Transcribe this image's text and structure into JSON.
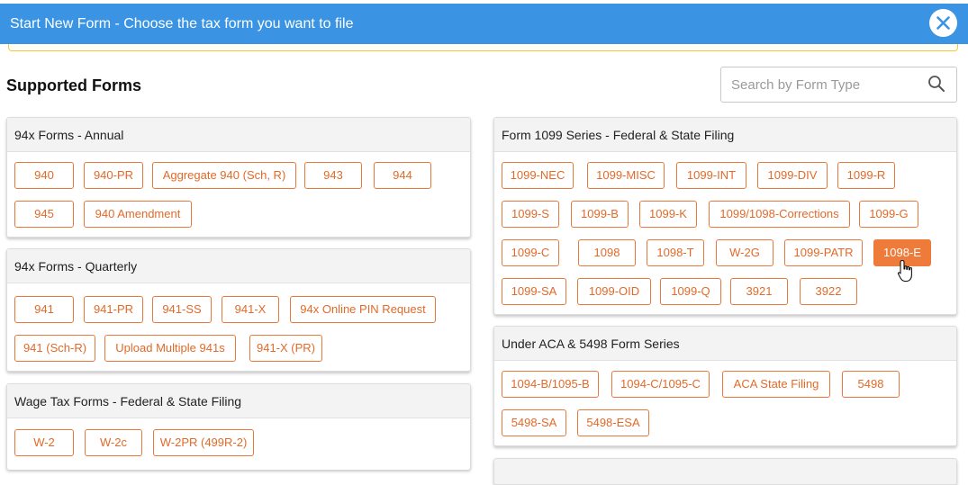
{
  "header": {
    "title": "Start New Form - Choose the tax form you want to file",
    "close_icon": "close-icon"
  },
  "main": {
    "section_title": "Supported Forms",
    "search": {
      "placeholder": "Search by Form Type",
      "value": "",
      "icon": "search-icon"
    }
  },
  "cards": {
    "annual": {
      "title": "94x Forms - Annual",
      "forms": [
        "940",
        "940-PR",
        "Aggregate 940 (Sch, R)",
        "943",
        "944",
        "945",
        "940 Amendment"
      ]
    },
    "quarterly": {
      "title": "94x Forms - Quarterly",
      "forms": [
        "941",
        "941-PR",
        "941-SS",
        "941-X",
        "94x Online PIN Request",
        "941 (Sch-R)",
        "Upload Multiple 941s",
        "941-X (PR)"
      ]
    },
    "wage": {
      "title": "Wage Tax Forms - Federal & State Filing",
      "forms": [
        "W-2",
        "W-2c",
        "W-2PR (499R-2)"
      ]
    },
    "f1099": {
      "title": "Form 1099 Series - Federal & State Filing",
      "forms": [
        "1099-NEC",
        "1099-MISC",
        "1099-INT",
        "1099-DIV",
        "1099-R",
        "1099-S",
        "1099-B",
        "1099-K",
        "1099/1098-Corrections",
        "1099-G",
        "1099-C",
        "1098",
        "1098-T",
        "W-2G",
        "1099-PATR",
        "1098-E",
        "1099-SA",
        "1099-OID",
        "1099-Q",
        "3921",
        "3922"
      ],
      "selected": "1098-E"
    },
    "aca": {
      "title": "Under ACA & 5498 Form Series",
      "forms": [
        "1094-B/1095-B",
        "1094-C/1095-C",
        "ACA State Filing",
        "5498",
        "5498-SA",
        "5498-ESA"
      ]
    }
  },
  "colors": {
    "header_bg": "#3a94e3",
    "accent_orange": "#e8783a",
    "warning_border": "#f3c93a"
  }
}
